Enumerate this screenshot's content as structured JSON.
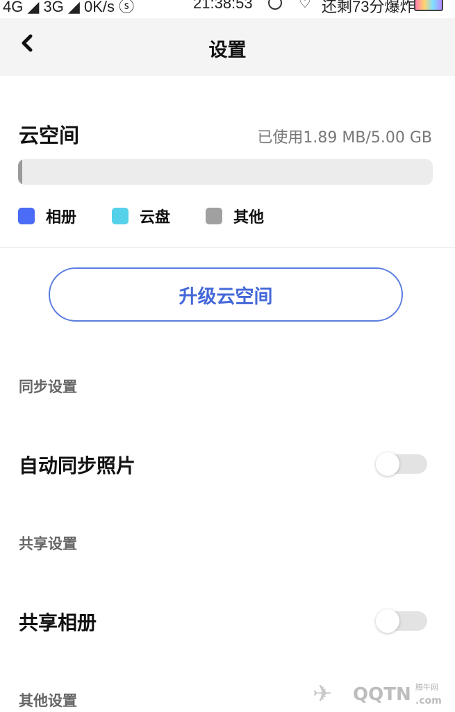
{
  "status_bar": {
    "left": "4G ◢ 3G ◢ 0K/s ⓢ",
    "time": "21:38:53",
    "right": "还剩73分爆炸"
  },
  "header": {
    "back_icon": "chevron-left-icon",
    "title": "设置"
  },
  "storage": {
    "title": "云空间",
    "usage_text": "已使用1.89 MB/5.00 GB",
    "used_fraction": 0.0004,
    "legend": [
      {
        "label": "相册",
        "color": "#4a6cf7"
      },
      {
        "label": "云盘",
        "color": "#55d2ea"
      },
      {
        "label": "其他",
        "color": "#a0a0a0"
      }
    ]
  },
  "upgrade_button": {
    "label": "升级云空间"
  },
  "sections": {
    "sync": {
      "title": "同步设置",
      "item_label": "自动同步照片",
      "toggle_on": false
    },
    "share": {
      "title": "共享设置",
      "item_label": "共享相册",
      "toggle_on": false
    },
    "other": {
      "title": "其他设置"
    }
  },
  "watermark": {
    "brand": "QQTN",
    "small": "腾牛网",
    "suffix": ".com"
  }
}
